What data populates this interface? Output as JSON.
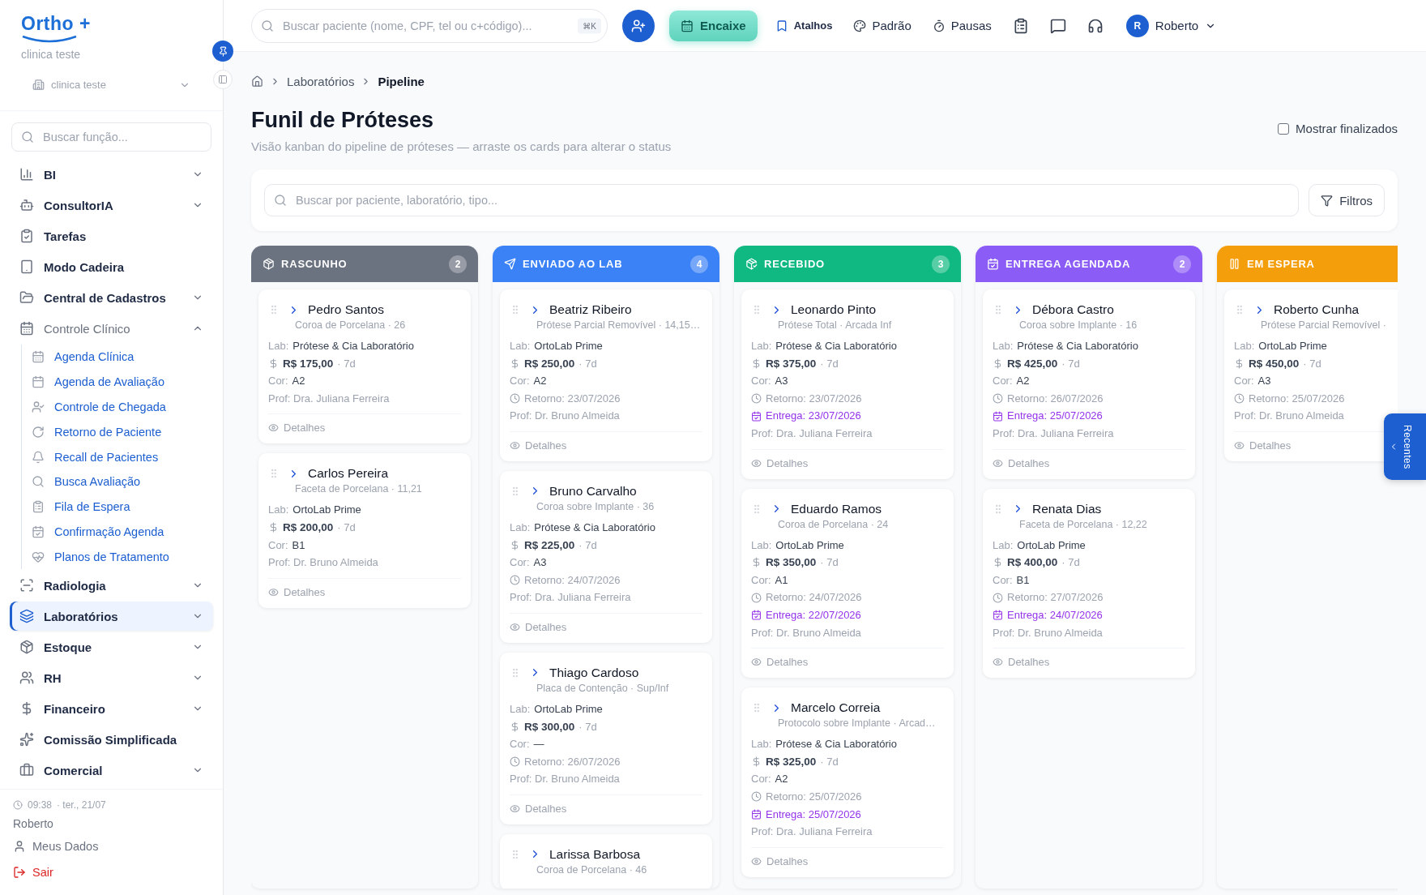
{
  "sidebar": {
    "logo": "Ortho +",
    "clinic_name": "clinica teste",
    "clinic_select": "clinica teste",
    "search_placeholder": "Buscar função...",
    "items": [
      {
        "label": "BI",
        "kind": "group",
        "expanded": false,
        "selected": false
      },
      {
        "label": "ConsultorIA",
        "kind": "group",
        "expanded": false,
        "selected": false
      },
      {
        "label": "Tarefas",
        "kind": "link",
        "selected": false
      },
      {
        "label": "Modo Cadeira",
        "kind": "link",
        "selected": false
      },
      {
        "label": "Central de Cadastros",
        "kind": "group",
        "expanded": false,
        "selected": false
      },
      {
        "label": "Controle Clínico",
        "kind": "group",
        "expanded": true,
        "selected": false,
        "children": [
          {
            "label": "Agenda Clínica",
            "selected": false
          },
          {
            "label": "Agenda de Avaliação",
            "selected": false
          },
          {
            "label": "Controle de Chegada",
            "selected": false
          },
          {
            "label": "Retorno de Paciente",
            "selected": false
          },
          {
            "label": "Recall de Pacientes",
            "selected": false
          },
          {
            "label": "Busca Avaliação",
            "selected": false
          },
          {
            "label": "Fila de Espera",
            "selected": false
          },
          {
            "label": "Confirmação Agenda",
            "selected": false
          },
          {
            "label": "Planos de Tratamento",
            "selected": false
          }
        ]
      },
      {
        "label": "Radiologia",
        "kind": "group",
        "expanded": false,
        "selected": false
      },
      {
        "label": "Laboratórios",
        "kind": "group",
        "expanded": false,
        "selected": true
      },
      {
        "label": "Estoque",
        "kind": "group",
        "expanded": false,
        "selected": false
      },
      {
        "label": "RH",
        "kind": "group",
        "expanded": false,
        "selected": false
      },
      {
        "label": "Financeiro",
        "kind": "group",
        "expanded": false,
        "selected": false
      },
      {
        "label": "Comissão Simplificada",
        "kind": "link",
        "selected": false
      },
      {
        "label": "Comercial",
        "kind": "group",
        "expanded": false,
        "selected": false
      }
    ],
    "footer": {
      "time": "09:38",
      "date": "· ter., 21/07",
      "user": "Roberto",
      "profile": "Meus Dados",
      "logout": "Sair"
    }
  },
  "topbar": {
    "search_placeholder": "Buscar paciente (nome, CPF, tel ou c+código)...",
    "shortcut": "⌘K",
    "encaixe": "Encaixe",
    "atalhos": "Atalhos",
    "padrao": "Padrão",
    "pausas": "Pausas",
    "avatar": "R",
    "user": "Roberto"
  },
  "breadcrumb": [
    "Laboratórios",
    "Pipeline"
  ],
  "title": "Funil de Próteses",
  "subtitle": "Visão kanban do pipeline de próteses — arraste os cards para alterar o status",
  "show_finished": {
    "label": "Mostrar finalizados",
    "checked": false
  },
  "filter": {
    "placeholder": "Buscar por paciente, laboratório, tipo...",
    "button": "Filtros"
  },
  "recent_tab": "Recentes",
  "columns": [
    {
      "title": "RASCUNHO",
      "count": "2",
      "color": "#6b7280",
      "cards": [
        {
          "name": "Pedro Santos",
          "subtitle": "Coroa de Porcelana · 26",
          "lines": [
            {
              "kind": "field",
              "label": "Lab:",
              "value": "Prótese & Cia Laboratório"
            },
            {
              "kind": "price",
              "value": "R$ 175,00",
              "meta": "· 7d"
            },
            {
              "kind": "field",
              "label": "Cor:",
              "value": "A2"
            },
            {
              "kind": "prof",
              "text": "Prof: Dra. Juliana Ferreira"
            }
          ],
          "action": "Detalhes"
        },
        {
          "name": "Carlos Pereira",
          "subtitle": "Faceta de Porcelana · 11,21",
          "lines": [
            {
              "kind": "field",
              "label": "Lab:",
              "value": "OrtoLab Prime"
            },
            {
              "kind": "price",
              "value": "R$ 200,00",
              "meta": "· 7d"
            },
            {
              "kind": "field",
              "label": "Cor:",
              "value": "B1"
            },
            {
              "kind": "prof",
              "text": "Prof: Dr. Bruno Almeida"
            }
          ],
          "action": "Detalhes"
        }
      ]
    },
    {
      "title": "ENVIADO AO LAB",
      "count": "4",
      "color": "#3b82f6",
      "cards": [
        {
          "name": "Beatriz Ribeiro",
          "subtitle": "Prótese Parcial Removível · 14,15…",
          "lines": [
            {
              "kind": "field",
              "label": "Lab:",
              "value": "OrtoLab Prime"
            },
            {
              "kind": "price",
              "value": "R$ 250,00",
              "meta": "· 7d"
            },
            {
              "kind": "field",
              "label": "Cor:",
              "value": "A2"
            },
            {
              "kind": "retorno",
              "text": "Retorno: 23/07/2026"
            },
            {
              "kind": "prof",
              "text": "Prof: Dr. Bruno Almeida"
            }
          ],
          "action": "Detalhes"
        },
        {
          "name": "Bruno Carvalho",
          "subtitle": "Coroa sobre Implante · 36",
          "lines": [
            {
              "kind": "field",
              "label": "Lab:",
              "value": "Prótese & Cia Laboratório"
            },
            {
              "kind": "price",
              "value": "R$ 225,00",
              "meta": "· 7d"
            },
            {
              "kind": "field",
              "label": "Cor:",
              "value": "A3"
            },
            {
              "kind": "retorno",
              "text": "Retorno: 24/07/2026"
            },
            {
              "kind": "prof",
              "text": "Prof: Dra. Juliana Ferreira"
            }
          ],
          "action": "Detalhes"
        },
        {
          "name": "Thiago Cardoso",
          "subtitle": "Placa de Contenção · Sup/Inf",
          "lines": [
            {
              "kind": "field",
              "label": "Lab:",
              "value": "OrtoLab Prime"
            },
            {
              "kind": "price",
              "value": "R$ 300,00",
              "meta": "· 7d"
            },
            {
              "kind": "field",
              "label": "Cor:",
              "value": "—"
            },
            {
              "kind": "retorno",
              "text": "Retorno: 26/07/2026"
            },
            {
              "kind": "prof",
              "text": "Prof: Dr. Bruno Almeida"
            }
          ],
          "action": "Detalhes"
        },
        {
          "name": "Larissa Barbosa",
          "subtitle": "Coroa de Porcelana · 46"
        }
      ]
    },
    {
      "title": "RECEBIDO",
      "count": "3",
      "color": "#10b981",
      "cards": [
        {
          "name": "Leonardo Pinto",
          "subtitle": "Prótese Total · Arcada Inf",
          "lines": [
            {
              "kind": "field",
              "label": "Lab:",
              "value": "Prótese & Cia Laboratório"
            },
            {
              "kind": "price",
              "value": "R$ 375,00",
              "meta": "· 7d"
            },
            {
              "kind": "field",
              "label": "Cor:",
              "value": "A3"
            },
            {
              "kind": "retorno",
              "text": "Retorno: 23/07/2026"
            },
            {
              "kind": "entrega",
              "text": "Entrega: 23/07/2026"
            },
            {
              "kind": "prof",
              "text": "Prof: Dra. Juliana Ferreira"
            }
          ],
          "action": "Detalhes"
        },
        {
          "name": "Eduardo Ramos",
          "subtitle": "Coroa de Porcelana · 24",
          "lines": [
            {
              "kind": "field",
              "label": "Lab:",
              "value": "OrtoLab Prime"
            },
            {
              "kind": "price",
              "value": "R$ 350,00",
              "meta": "· 7d"
            },
            {
              "kind": "field",
              "label": "Cor:",
              "value": "A1"
            },
            {
              "kind": "retorno",
              "text": "Retorno: 24/07/2026"
            },
            {
              "kind": "entrega",
              "text": "Entrega: 22/07/2026"
            },
            {
              "kind": "prof",
              "text": "Prof: Dr. Bruno Almeida"
            }
          ],
          "action": "Detalhes"
        },
        {
          "name": "Marcelo Correia",
          "subtitle": "Protocolo sobre Implante · Arcad…",
          "lines": [
            {
              "kind": "field",
              "label": "Lab:",
              "value": "Prótese & Cia Laboratório"
            },
            {
              "kind": "price",
              "value": "R$ 325,00",
              "meta": "· 7d"
            },
            {
              "kind": "field",
              "label": "Cor:",
              "value": "A2"
            },
            {
              "kind": "retorno",
              "text": "Retorno: 25/07/2026"
            },
            {
              "kind": "entrega",
              "text": "Entrega: 25/07/2026"
            },
            {
              "kind": "prof",
              "text": "Prof: Dra. Juliana Ferreira"
            }
          ],
          "action": "Detalhes"
        }
      ]
    },
    {
      "title": "ENTREGA AGENDADA",
      "count": "2",
      "color": "#8b5cf6",
      "cards": [
        {
          "name": "Débora Castro",
          "subtitle": "Coroa sobre Implante · 16",
          "lines": [
            {
              "kind": "field",
              "label": "Lab:",
              "value": "Prótese & Cia Laboratório"
            },
            {
              "kind": "price",
              "value": "R$ 425,00",
              "meta": "· 7d"
            },
            {
              "kind": "field",
              "label": "Cor:",
              "value": "A2"
            },
            {
              "kind": "retorno",
              "text": "Retorno: 26/07/2026"
            },
            {
              "kind": "entrega",
              "text": "Entrega: 25/07/2026"
            },
            {
              "kind": "prof",
              "text": "Prof: Dra. Juliana Ferreira"
            }
          ],
          "action": "Detalhes"
        },
        {
          "name": "Renata Dias",
          "subtitle": "Faceta de Porcelana · 12,22",
          "lines": [
            {
              "kind": "field",
              "label": "Lab:",
              "value": "OrtoLab Prime"
            },
            {
              "kind": "price",
              "value": "R$ 400,00",
              "meta": "· 7d"
            },
            {
              "kind": "field",
              "label": "Cor:",
              "value": "B1"
            },
            {
              "kind": "retorno",
              "text": "Retorno: 27/07/2026"
            },
            {
              "kind": "entrega",
              "text": "Entrega: 24/07/2026"
            },
            {
              "kind": "prof",
              "text": "Prof: Dr. Bruno Almeida"
            }
          ],
          "action": "Detalhes"
        }
      ]
    },
    {
      "title": "EM ESPERA",
      "color": "#f59e0b",
      "cards": [
        {
          "name": "Roberto Cunha",
          "subtitle": "Prótese Parcial Removível ·",
          "lines": [
            {
              "kind": "field",
              "label": "Lab:",
              "value": "OrtoLab Prime"
            },
            {
              "kind": "price",
              "value": "R$ 450,00",
              "meta": "· 7d"
            },
            {
              "kind": "field",
              "label": "Cor:",
              "value": "A3"
            },
            {
              "kind": "retorno",
              "text": "Retorno: 25/07/2026"
            },
            {
              "kind": "prof",
              "text": "Prof: Dr. Bruno Almeida"
            }
          ],
          "action": "Detalhes"
        }
      ]
    }
  ]
}
